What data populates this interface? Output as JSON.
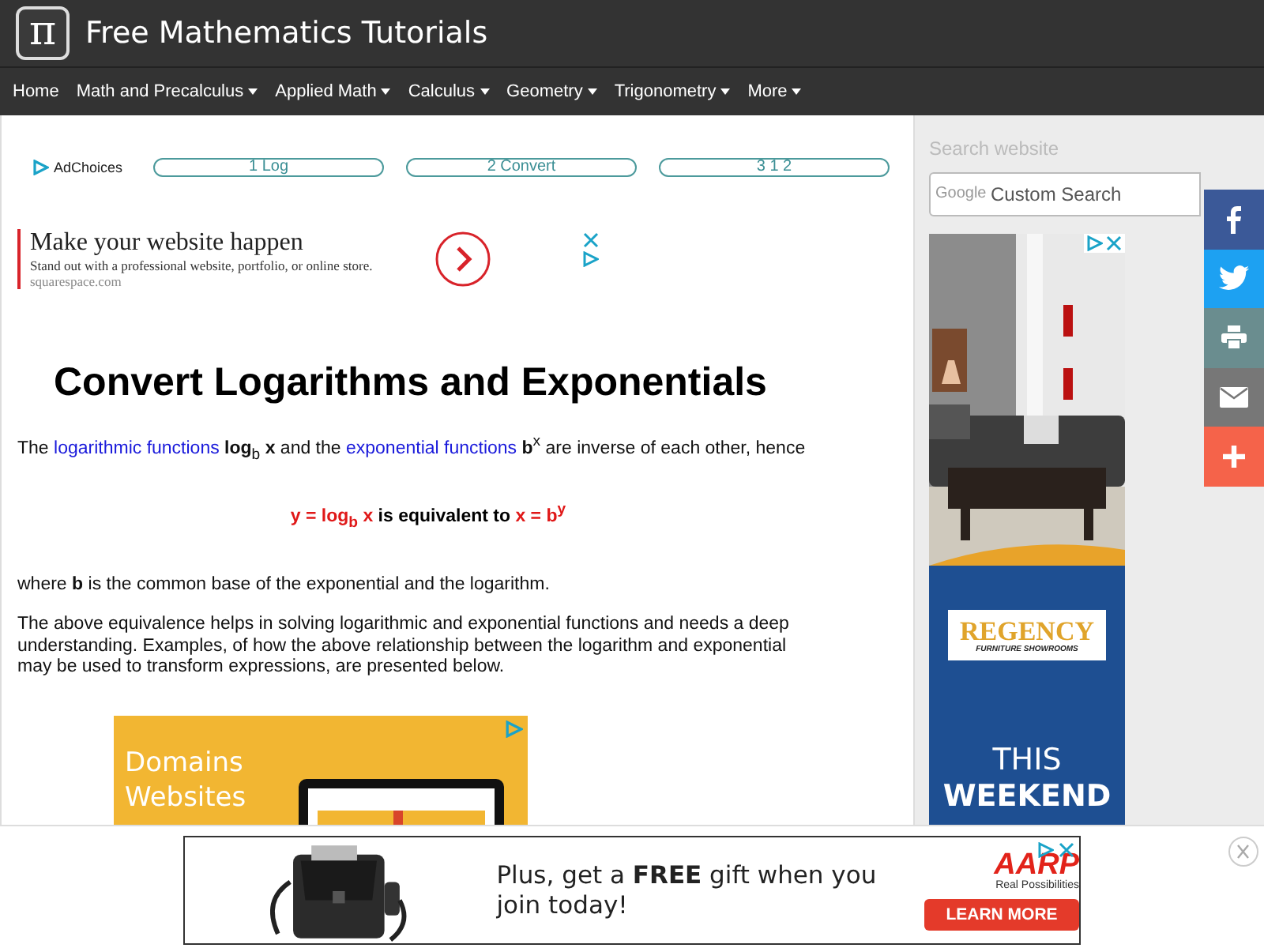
{
  "header": {
    "logo_glyph": "π",
    "title": "Free Mathematics Tutorials"
  },
  "nav": [
    {
      "label": "Home",
      "dropdown": false
    },
    {
      "label": "Math and Precalculus",
      "dropdown": true
    },
    {
      "label": "Applied Math",
      "dropdown": true
    },
    {
      "label": "Calculus",
      "dropdown": true
    },
    {
      "label": "Geometry",
      "dropdown": true
    },
    {
      "label": "Trigonometry",
      "dropdown": true
    },
    {
      "label": "More",
      "dropdown": true
    }
  ],
  "ad_links": {
    "adchoices": "AdChoices",
    "links": [
      "1 Log",
      "2 Convert",
      "3 1 2"
    ]
  },
  "text_ad": {
    "headline": "Make your website happen",
    "body": "Stand out with a professional website, portfolio, or online store.",
    "domain": "squarespace.com"
  },
  "article": {
    "title": "Convert Logarithms and Exponentials",
    "intro": [
      {
        "kind": "text",
        "text": "The "
      },
      {
        "kind": "link",
        "text": "logarithmic functions"
      },
      {
        "kind": "text",
        "text": " **log**$_{b}$ **x** and the "
      },
      {
        "kind": "link",
        "text": "exponential functions"
      },
      {
        "kind": "text",
        "text": " **b**$^{x}$ are inverse of each other, hence"
      }
    ],
    "equation": [
      {
        "kind": "math",
        "text": "y = log$_{b}$ x"
      },
      {
        "kind": "text",
        "text": " is equivalent to "
      },
      {
        "kind": "math",
        "text": "x = b$^{y}$"
      }
    ],
    "paragraphs": [
      "where **b** is the common base of the exponential and the logarithm.",
      "The above equivalence helps in solving logarithmic and exponential functions and needs a deep understanding. Examples, of how the above relationship between the logarithm and exponential may be used to transform expressions, are presented below."
    ]
  },
  "domains_ad": {
    "lines": [
      "Domains",
      "Websites"
    ]
  },
  "sidebar": {
    "search_label": "Search website",
    "search": {
      "brand": "Google",
      "placeholder": "Custom Search"
    },
    "ad": {
      "brand": "REGENCY",
      "tagline": "FURNITURE SHOWROOMS",
      "lines": [
        "THIS",
        "WEEKEND"
      ]
    }
  },
  "share": [
    {
      "kind": "facebook"
    },
    {
      "kind": "twitter"
    },
    {
      "kind": "print"
    },
    {
      "kind": "email"
    },
    {
      "kind": "more"
    }
  ],
  "bottom_ad": {
    "headline": "Plus, get a **FREE** gift when you join today!",
    "brand": "AARP",
    "tagline": "Real Possibilities",
    "cta": "LEARN MORE"
  }
}
